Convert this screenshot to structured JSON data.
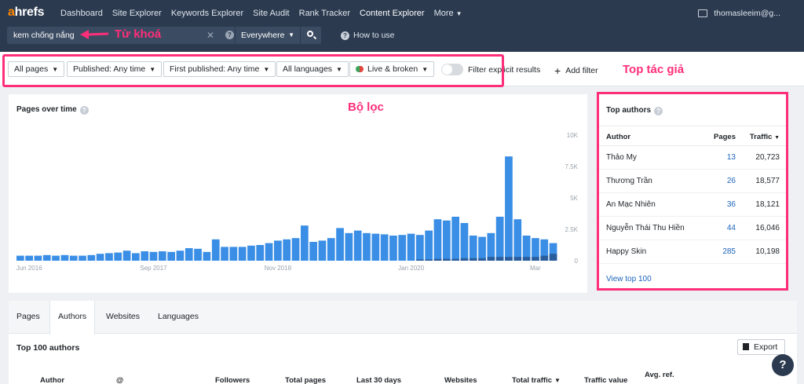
{
  "nav": {
    "logo_a": "a",
    "logo_rest": "hrefs",
    "items": [
      "Dashboard",
      "Site Explorer",
      "Keywords Explorer",
      "Site Audit",
      "Rank Tracker",
      "Content Explorer",
      "More"
    ],
    "user_email": "thomasleeim@g..."
  },
  "search": {
    "query": "kem chống nắng",
    "scope": "Everywhere",
    "how_to_use": "How to use"
  },
  "annotations": {
    "keyword": "Từ khoá",
    "filters": "Bộ lọc",
    "top_authors": "Top tác giả"
  },
  "filters": {
    "pages": "All pages",
    "published": "Published: Any time",
    "first_published": "First published: Any time",
    "languages": "All languages",
    "live": "Live & broken",
    "explicit": "Filter explicit results",
    "add": "Add filter"
  },
  "chart": {
    "title": "Pages over time",
    "color_main": "#3a8ee6",
    "color_dark": "#2a5d9c"
  },
  "chart_data": {
    "type": "bar",
    "title": "Pages over time",
    "x_tick_labels": [
      "Jun 2016",
      "Sep 2017",
      "Nov 2018",
      "Jan 2020",
      "Mar"
    ],
    "y_tick_labels": [
      "10K",
      "7.5K",
      "5K",
      "2.5K",
      "0"
    ],
    "ylim": [
      0,
      10000
    ],
    "y_axis_position": "right",
    "grid": false,
    "values": [
      400,
      400,
      400,
      450,
      400,
      450,
      400,
      400,
      450,
      550,
      600,
      650,
      800,
      600,
      750,
      700,
      750,
      700,
      800,
      1000,
      950,
      700,
      1700,
      1100,
      1100,
      1100,
      1200,
      1250,
      1400,
      1600,
      1700,
      1800,
      2800,
      1500,
      1600,
      1800,
      2600,
      2200,
      2400,
      2200,
      2150,
      2100,
      2000,
      2050,
      2150,
      2050,
      2400,
      3300,
      3200,
      3500,
      3000,
      2000,
      1900,
      2200,
      3500,
      8300,
      3300,
      2000,
      1800,
      1700,
      1400
    ],
    "overlay_values": [
      0,
      0,
      0,
      0,
      0,
      0,
      0,
      0,
      0,
      0,
      0,
      0,
      0,
      0,
      0,
      0,
      0,
      0,
      0,
      0,
      0,
      0,
      0,
      0,
      0,
      0,
      0,
      0,
      0,
      0,
      0,
      0,
      0,
      0,
      0,
      0,
      0,
      0,
      0,
      0,
      0,
      0,
      0,
      0,
      0,
      100,
      100,
      150,
      150,
      150,
      200,
      200,
      200,
      300,
      300,
      300,
      300,
      300,
      300,
      400,
      550
    ]
  },
  "authors": {
    "title": "Top authors",
    "col_author": "Author",
    "col_pages": "Pages",
    "col_traffic": "Traffic",
    "rows": [
      {
        "name": "Thảo My",
        "pages": "13",
        "traffic": "20,723"
      },
      {
        "name": "Thương Trần",
        "pages": "26",
        "traffic": "18,577"
      },
      {
        "name": "An Mạc Nhiên",
        "pages": "36",
        "traffic": "18,121"
      },
      {
        "name": "Nguyễn Thái Thu Hiền",
        "pages": "44",
        "traffic": "16,046"
      },
      {
        "name": "Happy Skin",
        "pages": "285",
        "traffic": "10,198"
      }
    ],
    "view_top": "View top 100"
  },
  "bottom": {
    "tabs": [
      "Pages",
      "Authors",
      "Websites",
      "Languages"
    ],
    "active_tab": "Authors",
    "section_title": "Top 100 authors",
    "export": "Export",
    "columns": [
      "Author",
      "@",
      "Followers",
      "Total pages",
      "Last 30 days",
      "Websites",
      "Total traffic",
      "Traffic value",
      "Avg. ref."
    ]
  },
  "help_fab": "?"
}
